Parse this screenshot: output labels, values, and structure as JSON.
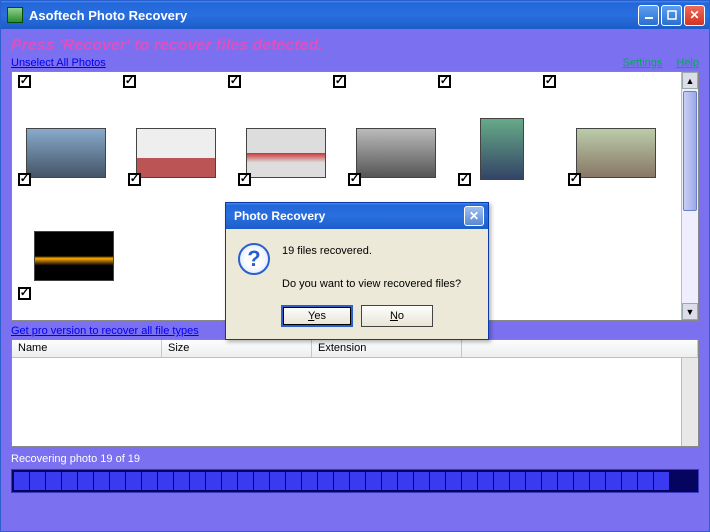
{
  "titlebar": {
    "title": "Asoftech Photo Recovery"
  },
  "instruction": "Press 'Recover' to recover files detected.",
  "links": {
    "unselect": "Unselect All Photos",
    "settings": "Settings",
    "help": "Help",
    "pro": "Get pro version to recover all file types"
  },
  "table": {
    "columns": [
      "Name",
      "Size",
      "Extension",
      ""
    ]
  },
  "status": "Recovering photo 19 of 19",
  "progress_segments": 41,
  "dialog": {
    "title": "Photo Recovery",
    "line1": "19 files recovered.",
    "line2": "Do you want to view recovered files?",
    "yes": "Yes",
    "no": "No"
  }
}
